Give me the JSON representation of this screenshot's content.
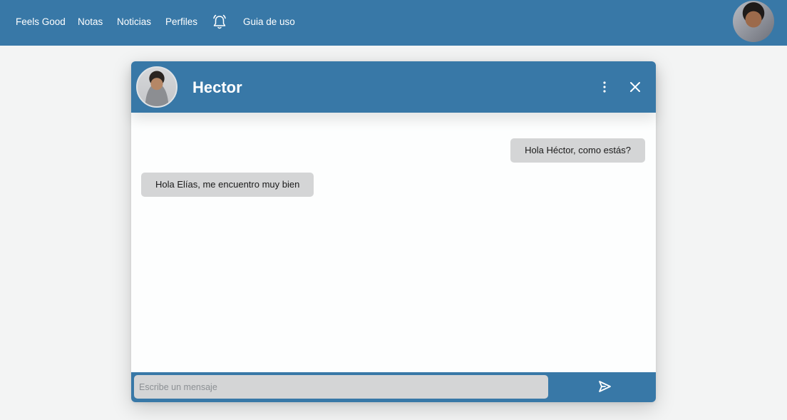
{
  "navbar": {
    "links": [
      "Feels Good",
      "Notas",
      "Noticias",
      "Perfiles",
      "Guia de uso"
    ],
    "bell_icon": "bell-icon",
    "avatar_icon": "user-avatar"
  },
  "chat": {
    "contact_name": "Hector",
    "header_icons": [
      "more-vertical-icon",
      "close-icon"
    ],
    "messages": [
      {
        "direction": "sent",
        "text": "Hola Héctor, como estás?"
      },
      {
        "direction": "received",
        "text": "Hola Elías, me encuentro muy bien"
      }
    ],
    "composer": {
      "placeholder": "Escribe un mensaje",
      "value": "",
      "send_icon": "send-icon"
    }
  },
  "colors": {
    "primary": "#3878a7",
    "background": "#f3f4f4",
    "bubble": "#d4d5d6",
    "chat_body": "#fdfefe"
  }
}
